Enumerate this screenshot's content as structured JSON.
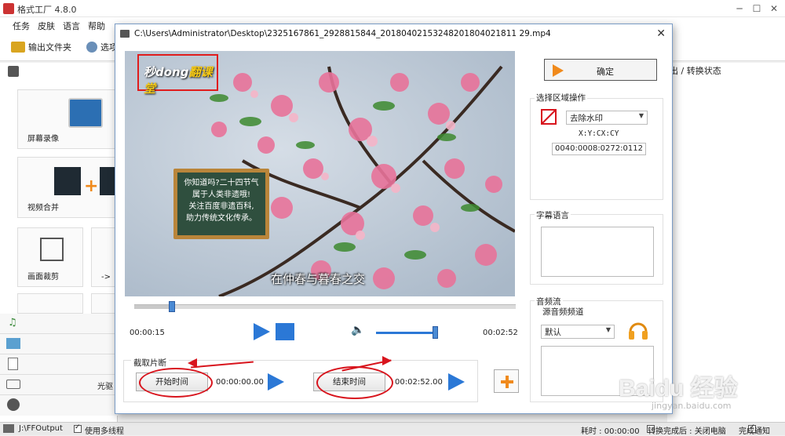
{
  "app": {
    "title": "格式工厂 4.8.0",
    "menu": [
      "任务",
      "皮肤",
      "语言",
      "帮助"
    ],
    "toolbar": {
      "output_folder": "输出文件夹",
      "options": "选项"
    },
    "tiles": {
      "screen_record": "屏幕录像",
      "video_merge": "视频合并",
      "crop": "画面裁剪",
      "to": "-> ",
      "optical": "光驱"
    },
    "status_header": "出 / 转换状态"
  },
  "statusbar": {
    "output_path": "J:\\FFOutput",
    "multithread": "使用多线程",
    "elapsed": "耗时 : 00:00:00",
    "after_convert": "转换完成后 : 关闭电脑",
    "notify": "完成通知"
  },
  "dialog": {
    "path": "C:\\Users\\Administrator\\Desktop\\2325167861_2928815844_20180402153248201804021811 29.mp4",
    "video": {
      "logo": {
        "part1": "秒dong",
        "part2": "翻课堂"
      },
      "board_text": "你知道吗?二十四节气\n属于人类非遗哦!\n关注百度非遗百科,\n助力传统文化传承。",
      "subtitle": "在仲春与暮春之交"
    },
    "player": {
      "current_time": "00:00:15",
      "total_time": "00:02:52",
      "progress": 0.09,
      "volume": 0.9
    },
    "clip": {
      "label": "截取片断",
      "start_btn": "开始时间",
      "start_value": "00:00:00.00",
      "end_btn": "结束时间",
      "end_value": "00:02:52.00"
    },
    "ok_label": "确定",
    "region": {
      "title": "选择区域操作",
      "operation": "去除水印",
      "coord_label": "X:Y:CX:CY",
      "coord_value": "0040:0008:0272:0112"
    },
    "subtitle_lang": {
      "title": "字幕语言"
    },
    "audio": {
      "title": "音频流",
      "source_label": "源音频频道",
      "source_value": "默认"
    }
  },
  "watermark": {
    "brand": "Baidu 经验",
    "url": "jingyan.baidu.com"
  }
}
